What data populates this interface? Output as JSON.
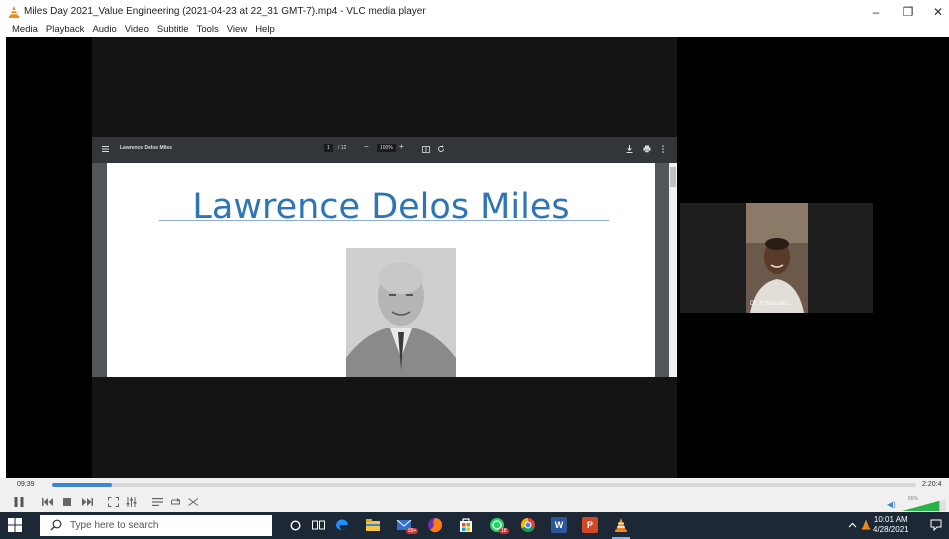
{
  "window": {
    "title": "Miles Day 2021_Value Engineering  (2021-04-23 at 22_31 GMT-7).mp4 - VLC media player",
    "min_glyph": "–",
    "max_glyph": "❐",
    "close_glyph": "✕"
  },
  "menu": [
    "Media",
    "Playback",
    "Audio",
    "Video",
    "Subtitle",
    "Tools",
    "View",
    "Help"
  ],
  "pdf_viewer": {
    "doc_name": "Lawrence Delos Miles",
    "page_current": "1",
    "page_total": "/ 12",
    "zoom": "100%"
  },
  "slide": {
    "title": "Lawrence Delos Miles"
  },
  "participant": {
    "name": "Dr. H Ramakri..."
  },
  "player": {
    "time_current": "09:39",
    "time_total": "2:20:4",
    "progress": 0.07,
    "volume_label": "85%",
    "volume": 0.85
  },
  "taskbar": {
    "search_placeholder": "Type here to search",
    "clock_time": "10:01 AM",
    "clock_date": "4/28/2021",
    "badge_mail": "99+",
    "badge_whatsapp": "18"
  },
  "colors": {
    "accent": "#3d86d6",
    "slide_title": "#2e75b6",
    "taskbar": "#1c2836"
  }
}
